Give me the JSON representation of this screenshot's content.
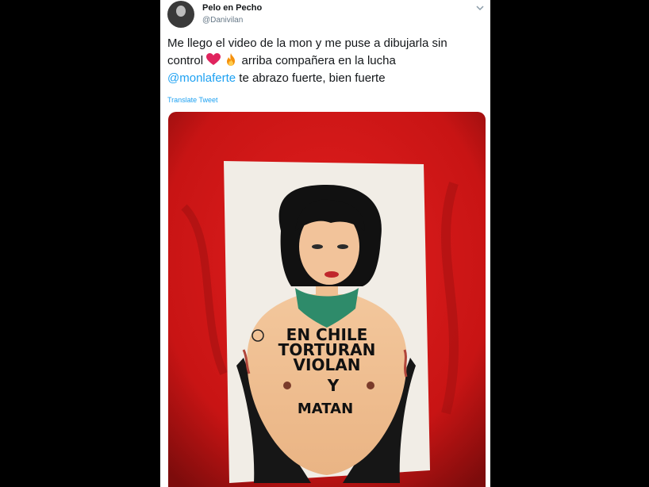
{
  "tweet": {
    "name": "Pelo en Pecho",
    "handle": "@Danivilan",
    "text_line1": "Me llego el video de la mon y me puse a dibujarla sin",
    "text_line2a": "control",
    "text_line2b": "arriba compañera en la lucha",
    "mention": "@monlaferte",
    "text_line3": "te abrazo fuerte, bien fuerte",
    "translate_label": "Translate Tweet",
    "emojis": [
      "red-heart-icon",
      "fire-icon"
    ]
  },
  "drawing": {
    "lettering": [
      "EN CHILE",
      "TORTURAN",
      "VIOLAN",
      "Y",
      "MATAN"
    ]
  },
  "colors": {
    "link": "#1da1f2",
    "background_fabric": "#d01818",
    "scarf": "#2e8b6a"
  }
}
